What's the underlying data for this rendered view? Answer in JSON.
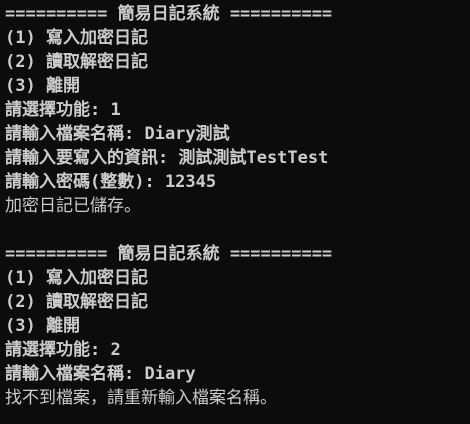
{
  "terminal": {
    "background": "#0c0c0c",
    "foreground": "#cccccc",
    "lines": [
      "========== 簡易日記系統 ==========",
      "(1) 寫入加密日記",
      "(2) 讀取解密日記",
      "(3) 離開",
      "請選擇功能: 1",
      "請輸入檔案名稱: Diary測試",
      "請輸入要寫入的資訊: 測試測試TestTest",
      "請輸入密碼(整數): 12345",
      "加密日記已儲存。",
      "",
      "========== 簡易日記系統 ==========",
      "(1) 寫入加密日記",
      "(2) 讀取解密日記",
      "(3) 離開",
      "請選擇功能: 2",
      "請輸入檔案名稱: Diary",
      "找不到檔案，請重新輸入檔案名稱。"
    ]
  }
}
